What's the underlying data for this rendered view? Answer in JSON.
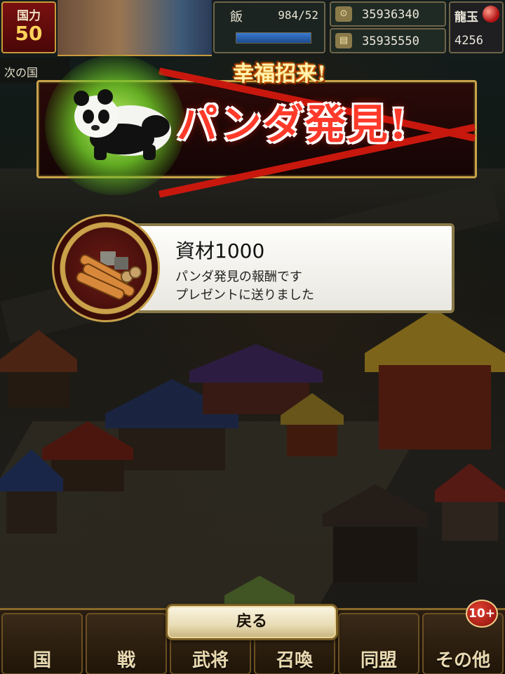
{
  "hud": {
    "power_label": "国力",
    "power_value": "50",
    "food_label": "飯",
    "food_value": "984/52",
    "coin1": "35936340",
    "coin2": "35935550",
    "ryugyoku_label": "龍玉",
    "ryugyoku_value": "4256",
    "next_country": "次の国"
  },
  "banner": {
    "subtitle": "幸福招来!",
    "title": "パンダ発見!"
  },
  "reward": {
    "title": "資材1000",
    "line1": "パンダ発見の報酬です",
    "line2": "プレゼントに送りました",
    "icon": "lumber-resource-icon"
  },
  "back_button": "戻る",
  "nav": {
    "items": [
      "国",
      "戦",
      "武将",
      "召喚",
      "同盟",
      "その他"
    ],
    "badge": "10+"
  },
  "colors": {
    "accent_gold": "#c9a24a",
    "banner_red": "#ff3a2a",
    "panda_glow": "#8fdc3c"
  }
}
